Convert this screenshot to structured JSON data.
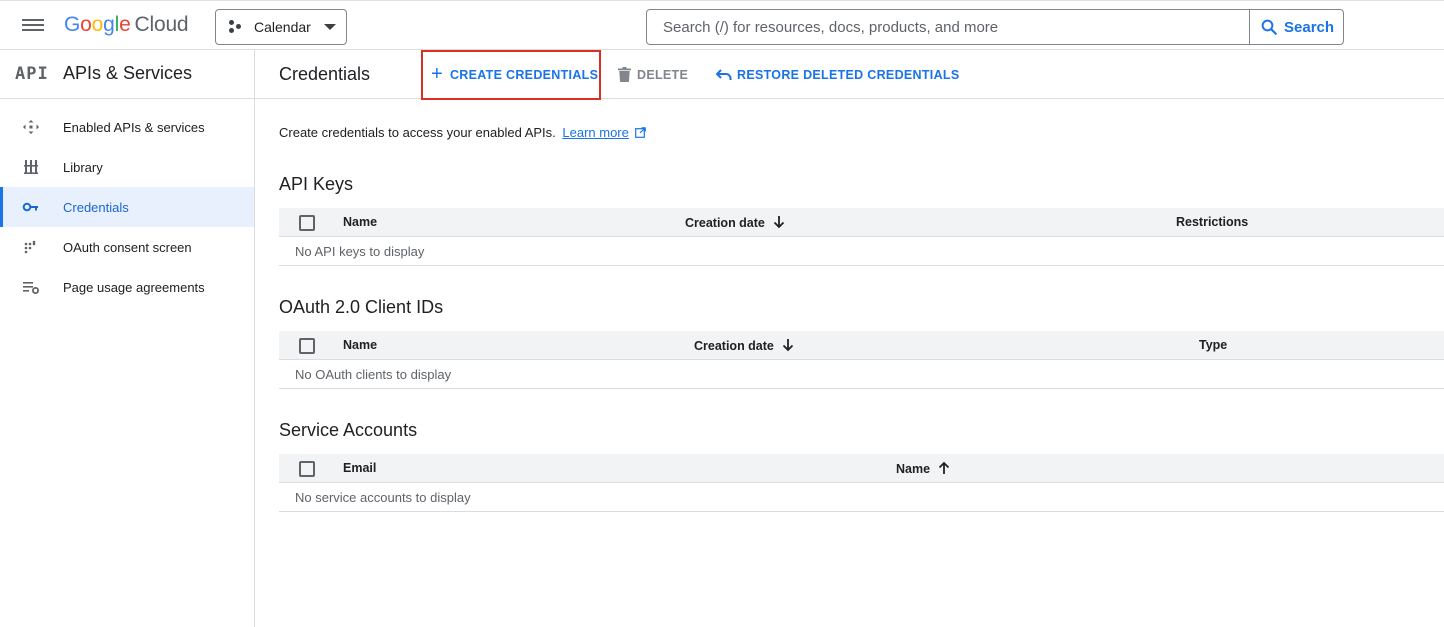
{
  "header": {
    "logo": {
      "letters": [
        "G",
        "o",
        "o",
        "g",
        "l",
        "e"
      ],
      "product": "Cloud"
    },
    "project": "Calendar",
    "search": {
      "placeholder": "Search (/) for resources, docs, products, and more",
      "button_label": "Search"
    }
  },
  "sidebar": {
    "logo_text": "API",
    "title": "APIs & Services",
    "items": [
      {
        "label": "Enabled APIs & services",
        "icon": "enabled-apis-icon"
      },
      {
        "label": "Library",
        "icon": "library-icon"
      },
      {
        "label": "Credentials",
        "icon": "key-icon",
        "active": true
      },
      {
        "label": "OAuth consent screen",
        "icon": "oauth-icon"
      },
      {
        "label": "Page usage agreements",
        "icon": "page-settings-icon"
      }
    ]
  },
  "main": {
    "title": "Credentials",
    "actions": {
      "create": "CREATE CREDENTIALS",
      "delete": "DELETE",
      "restore": "RESTORE DELETED CREDENTIALS"
    },
    "intro_text": "Create credentials to access your enabled APIs.",
    "learn_more": "Learn more",
    "sections": [
      {
        "title": "API Keys",
        "columns": [
          "Name",
          "Creation date",
          "Restrictions"
        ],
        "empty": "No API keys to display"
      },
      {
        "title": "OAuth 2.0 Client IDs",
        "columns": [
          "Name",
          "Creation date",
          "Type"
        ],
        "empty": "No OAuth clients to display"
      },
      {
        "title": "Service Accounts",
        "columns": [
          "Email",
          "Name"
        ],
        "empty": "No service accounts to display"
      }
    ]
  },
  "colors": {
    "accent": "#1a73e8",
    "highlight_border": "#d93025",
    "active_bg": "#e8f0fe"
  }
}
